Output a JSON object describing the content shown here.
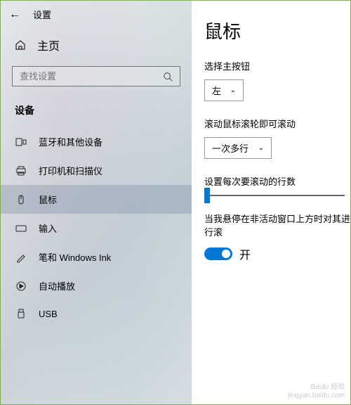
{
  "header": {
    "title": "设置"
  },
  "home": {
    "label": "主页"
  },
  "search": {
    "placeholder": "查找设置"
  },
  "section": {
    "label": "设备"
  },
  "nav": {
    "items": [
      {
        "label": "蓝牙和其他设备"
      },
      {
        "label": "打印机和扫描仪"
      },
      {
        "label": "鼠标"
      },
      {
        "label": "输入"
      },
      {
        "label": "笔和 Windows Ink"
      },
      {
        "label": "自动播放"
      },
      {
        "label": "USB"
      }
    ]
  },
  "main": {
    "title": "鼠标",
    "primary_button": {
      "label": "选择主按钮",
      "value": "左"
    },
    "scroll_wheel": {
      "label": "滚动鼠标滚轮即可滚动",
      "value": "一次多行"
    },
    "lines_to_scroll": {
      "label": "设置每次要滚动的行数"
    },
    "inactive_scroll": {
      "label": "当我悬停在非活动窗口上方时对其进行滚",
      "state": "开"
    }
  },
  "watermark": {
    "brand": "Baidu 经验",
    "url": "jingyan.baidu.com"
  }
}
